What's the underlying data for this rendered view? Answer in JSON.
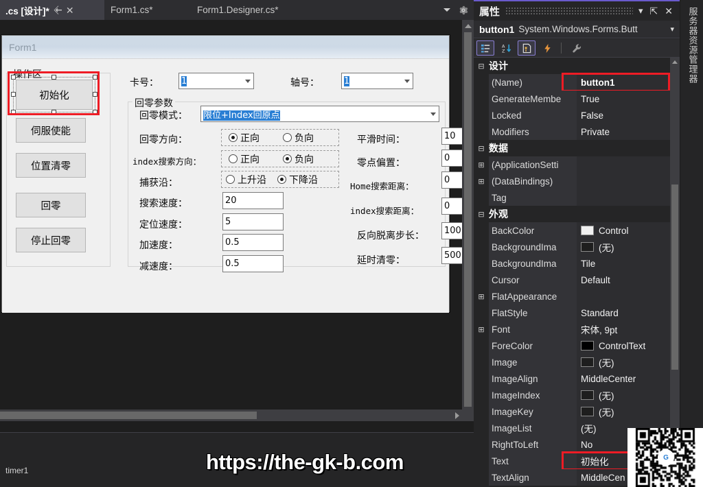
{
  "tabs": [
    {
      "label": ".cs [设计]*",
      "active": true,
      "pin": true,
      "close": true
    },
    {
      "label": "Form1.cs*",
      "active": false
    },
    {
      "label": "Form1.Designer.cs*",
      "active": false
    }
  ],
  "tabstrip": {
    "dropdown_icon": "chevron-down-icon",
    "settings_icon": "gear-icon"
  },
  "form": {
    "caption": "Form1",
    "operation_group_title": "操作区",
    "buttons": [
      {
        "label": "初始化",
        "selected": true
      },
      {
        "label": "伺服使能",
        "selected": false
      },
      {
        "label": "位置清零",
        "selected": false
      },
      {
        "label": "回零",
        "selected": false
      },
      {
        "label": "停止回零",
        "selected": false
      }
    ],
    "card_label": "卡号：",
    "card_value": "1",
    "axis_label": "轴号：",
    "axis_value": "1",
    "home_group_title": "回零参数",
    "home_mode_label": "回零模式：",
    "home_mode_value": "限位+Index回原点",
    "rows_left": [
      {
        "label": "回零方向：",
        "type": "radio",
        "options": [
          "正向",
          "负向"
        ],
        "selected": 0
      },
      {
        "label": "index搜索方向：",
        "type": "radio",
        "options": [
          "正向",
          "负向"
        ],
        "selected": 1,
        "mono": true
      },
      {
        "label": "捕获沿：",
        "type": "radio",
        "options": [
          "上升沿",
          "下降沿"
        ],
        "selected": 1
      },
      {
        "label": "搜索速度：",
        "type": "text",
        "value": "20"
      },
      {
        "label": "定位速度：",
        "type": "text",
        "value": "5"
      },
      {
        "label": "加速度：",
        "type": "text",
        "value": "0.5"
      },
      {
        "label": "减速度：",
        "type": "text",
        "value": "0.5"
      }
    ],
    "rows_right": [
      {
        "label": "平滑时间：",
        "value": "10"
      },
      {
        "label": "零点偏置：",
        "value": "0"
      },
      {
        "label": "Home搜索距离：",
        "value": "0",
        "mono": true
      },
      {
        "label": "index搜索距离：",
        "value": "0",
        "mono": true
      },
      {
        "label": "反向脱离步长：",
        "value": "100"
      },
      {
        "label": "延时清零：",
        "value": "500"
      }
    ]
  },
  "tray": {
    "item_label": "timer1"
  },
  "properties": {
    "title": "属性",
    "dropdown_icon": "chevron-down-icon",
    "pin_icon": "pin-icon",
    "close_icon": "close-icon",
    "object_name": "button1",
    "object_type": "System.Windows.Forms.Butt",
    "object_caret": "chevron-down-icon",
    "toolbar": [
      {
        "name": "categorized-icon",
        "selected": true
      },
      {
        "name": "alphabetical-sort-icon",
        "selected": false
      },
      {
        "name": "properties-page-icon",
        "selected": true
      },
      {
        "name": "events-lightning-icon",
        "selected": false
      },
      {
        "name": "wrench-icon",
        "selected": false
      }
    ],
    "rows": [
      {
        "kind": "category",
        "expander": "−",
        "name": "设计"
      },
      {
        "kind": "prop",
        "name": "(Name)",
        "value": "button1",
        "bold": true,
        "highlight": true
      },
      {
        "kind": "prop",
        "name": "GenerateMembe",
        "value": "True"
      },
      {
        "kind": "prop",
        "name": "Locked",
        "value": "False"
      },
      {
        "kind": "prop",
        "name": "Modifiers",
        "value": "Private"
      },
      {
        "kind": "category",
        "expander": "−",
        "name": "数据"
      },
      {
        "kind": "prop",
        "expander": "+",
        "name": "(ApplicationSetti",
        "value": ""
      },
      {
        "kind": "prop",
        "expander": "+",
        "name": "(DataBindings)",
        "value": ""
      },
      {
        "kind": "prop",
        "name": "Tag",
        "value": ""
      },
      {
        "kind": "category",
        "expander": "−",
        "name": "外观"
      },
      {
        "kind": "prop",
        "name": "BackColor",
        "value": "Control",
        "swatch": "#f0f0f0"
      },
      {
        "kind": "prop",
        "name": "BackgroundIma",
        "value": "(无)",
        "swatch": "#1e1e1e"
      },
      {
        "kind": "prop",
        "name": "BackgroundIma",
        "value": "Tile"
      },
      {
        "kind": "prop",
        "name": "Cursor",
        "value": "Default"
      },
      {
        "kind": "prop",
        "expander": "+",
        "name": "FlatAppearance",
        "value": ""
      },
      {
        "kind": "prop",
        "name": "FlatStyle",
        "value": "Standard"
      },
      {
        "kind": "prop",
        "expander": "+",
        "name": "Font",
        "value": "宋体, 9pt"
      },
      {
        "kind": "prop",
        "name": "ForeColor",
        "value": "ControlText",
        "swatch": "#000000"
      },
      {
        "kind": "prop",
        "name": "Image",
        "value": "(无)",
        "swatch": "#1e1e1e"
      },
      {
        "kind": "prop",
        "name": "ImageAlign",
        "value": "MiddleCenter"
      },
      {
        "kind": "prop",
        "name": "ImageIndex",
        "value": "(无)",
        "swatch": "#1e1e1e"
      },
      {
        "kind": "prop",
        "name": "ImageKey",
        "value": "(无)",
        "swatch": "#1e1e1e"
      },
      {
        "kind": "prop",
        "name": "ImageList",
        "value": "(无)"
      },
      {
        "kind": "prop",
        "name": "RightToLeft",
        "value": "No"
      },
      {
        "kind": "prop",
        "name": "Text",
        "value": "初始化",
        "highlight": true
      },
      {
        "kind": "prop",
        "name": "TextAlign",
        "value": "MiddleCen"
      }
    ]
  },
  "right_strip": {
    "label": "服务器资源管理器"
  },
  "watermark": {
    "text": "https://the-gk-b.com"
  },
  "colors": {
    "accent_purple": "#6a5acd",
    "highlight_red": "#ee1c25",
    "selection_blue": "#2a7fd4",
    "panel_bg": "#252526",
    "editor_bg": "#1e1e1e",
    "form_bg": "#f0f0f0"
  }
}
